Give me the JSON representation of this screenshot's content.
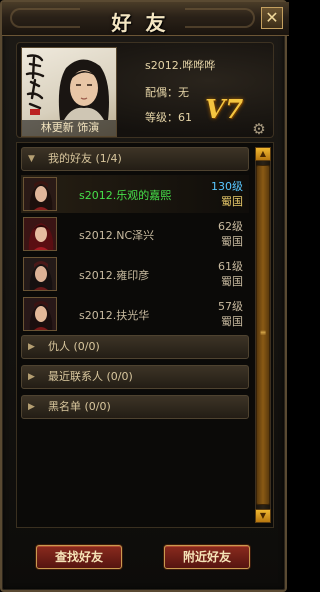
{
  "window": {
    "title": "好友"
  },
  "profile": {
    "portrait_caption": "林更新 饰演",
    "name": "s2012.哗哗哗",
    "spouse": "配偶：无",
    "level": "等级：61",
    "vip": "V7"
  },
  "groups": [
    {
      "label": "我的好友 (1/4)",
      "expanded": true
    },
    {
      "label": "仇人 (0/0)",
      "expanded": false
    },
    {
      "label": "最近联系人 (0/0)",
      "expanded": false
    },
    {
      "label": "黑名单 (0/0)",
      "expanded": false
    }
  ],
  "friends": [
    {
      "name": "s2012.乐观的嘉熙",
      "level": "130级",
      "nation": "蜀国",
      "online": true
    },
    {
      "name": "s2012.NC泽兴",
      "level": "62级",
      "nation": "蜀国",
      "online": false
    },
    {
      "name": "s2012.雍印彦",
      "level": "61级",
      "nation": "蜀国",
      "online": false
    },
    {
      "name": "s2012.扶光华",
      "level": "57级",
      "nation": "蜀国",
      "online": false
    }
  ],
  "buttons": {
    "find": "查找好友",
    "nearby": "附近好友"
  },
  "icons": {
    "close": "close-icon",
    "settings": "gear-icon",
    "scroll_up": "scroll-up-icon",
    "scroll_down": "scroll-down-icon"
  },
  "colors": {
    "online_name": "#46e04a",
    "online_level": "#59c7ff",
    "vip": "#f5c540"
  }
}
